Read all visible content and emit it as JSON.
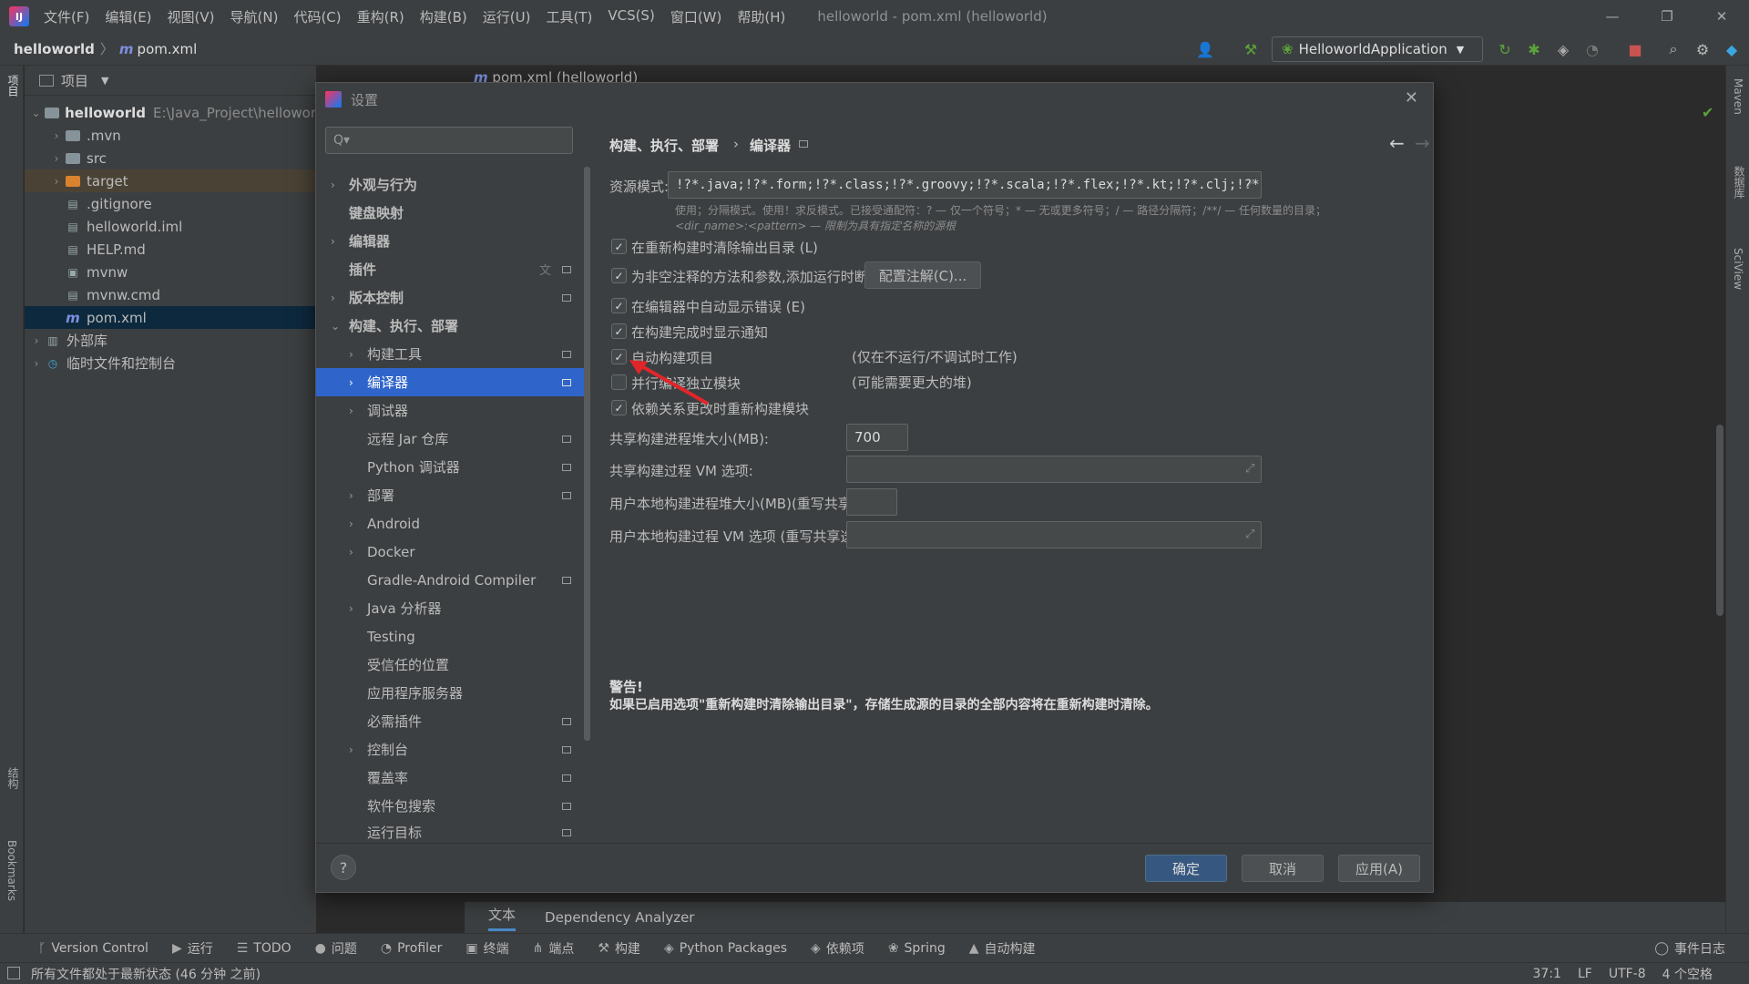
{
  "app": {
    "window_title": "helloworld - pom.xml (helloworld)",
    "menu": [
      "文件(F)",
      "编辑(E)",
      "视图(V)",
      "导航(N)",
      "代码(C)",
      "重构(R)",
      "构建(B)",
      "运行(U)",
      "工具(T)",
      "VCS(S)",
      "窗口(W)",
      "帮助(H)"
    ]
  },
  "navbar": {
    "project": "helloworld",
    "file": "pom.xml",
    "run_config": "HelloworldApplication"
  },
  "project_panel": {
    "title": "项目",
    "root_name": "helloworld",
    "root_path": "E:\\Java_Project\\hellowor",
    "items": [
      ".mvn",
      "src",
      "target",
      ".gitignore",
      "helloworld.iml",
      "HELP.md",
      "mvnw",
      "mvnw.cmd",
      "pom.xml"
    ],
    "external_libs": "外部库",
    "scratches": "临时文件和控制台"
  },
  "editor": {
    "tab": "pom.xml (helloworld)"
  },
  "left_stripe": {
    "project": "项目",
    "structure": "结构",
    "bookmarks": "Bookmarks"
  },
  "right_stripe": {
    "maven": "Maven",
    "database": "数据库",
    "sciview": "SciView"
  },
  "bottom_tabs": {
    "text": "文本",
    "dependency": "Dependency Analyzer"
  },
  "tool_windows": [
    "Version Control",
    "运行",
    "TODO",
    "问题",
    "Profiler",
    "终端",
    "端点",
    "构建",
    "Python Packages",
    "依赖项",
    "Spring",
    "自动构建"
  ],
  "event_log": "事件日志",
  "status": {
    "message": "所有文件都处于最新状态 (46 分钟 之前)",
    "position": "37:1",
    "line_sep": "LF",
    "encoding": "UTF-8",
    "indent": "4 个空格"
  },
  "dialog": {
    "title": "设置",
    "search_placeholder": "Q▾",
    "breadcrumb_parent": "构建、执行、部署",
    "breadcrumb_current": "编译器",
    "tree": [
      {
        "label": "外观与行为",
        "arrow": true,
        "indent": 0,
        "mark": false
      },
      {
        "label": "键盘映射",
        "arrow": false,
        "indent": 0,
        "mark": false
      },
      {
        "label": "编辑器",
        "arrow": true,
        "indent": 0,
        "mark": false
      },
      {
        "label": "插件",
        "arrow": false,
        "indent": 0,
        "mark": true
      },
      {
        "label": "版本控制",
        "arrow": true,
        "indent": 0,
        "mark": true
      },
      {
        "label": "构建、执行、部署",
        "arrow": true,
        "indent": 0,
        "mark": false
      },
      {
        "label": "构建工具",
        "arrow": true,
        "indent": 1,
        "mark": true
      },
      {
        "label": "编译器",
        "arrow": true,
        "indent": 1,
        "mark": true
      },
      {
        "label": "调试器",
        "arrow": true,
        "indent": 1,
        "mark": false
      },
      {
        "label": "远程 Jar 仓库",
        "arrow": false,
        "indent": 1,
        "mark": true
      },
      {
        "label": "Python 调试器",
        "arrow": false,
        "indent": 1,
        "mark": true
      },
      {
        "label": "部署",
        "arrow": true,
        "indent": 1,
        "mark": true
      },
      {
        "label": "Android",
        "arrow": true,
        "indent": 1,
        "mark": false
      },
      {
        "label": "Docker",
        "arrow": true,
        "indent": 1,
        "mark": false
      },
      {
        "label": "Gradle-Android Compiler",
        "arrow": false,
        "indent": 1,
        "mark": true
      },
      {
        "label": "Java 分析器",
        "arrow": true,
        "indent": 1,
        "mark": false
      },
      {
        "label": "Testing",
        "arrow": false,
        "indent": 1,
        "mark": false
      },
      {
        "label": "受信任的位置",
        "arrow": false,
        "indent": 1,
        "mark": false
      },
      {
        "label": "应用程序服务器",
        "arrow": false,
        "indent": 1,
        "mark": false
      },
      {
        "label": "必需插件",
        "arrow": false,
        "indent": 1,
        "mark": true
      },
      {
        "label": "控制台",
        "arrow": true,
        "indent": 1,
        "mark": true
      },
      {
        "label": "覆盖率",
        "arrow": false,
        "indent": 1,
        "mark": true
      },
      {
        "label": "软件包搜索",
        "arrow": false,
        "indent": 1,
        "mark": true
      },
      {
        "label": "运行目标",
        "arrow": false,
        "indent": 1,
        "mark": true
      }
    ],
    "resource_label": "资源模式:",
    "resource_value": "!?*.java;!?*.form;!?*.class;!?*.groovy;!?*.scala;!?*.flex;!?*.kt;!?*.clj;!?*.aj",
    "resource_hint1": "使用；分隔模式。使用！求反模式。已接受通配符：? — 仅一个符号；* — 无或更多符号；/ — 路径分隔符；/**/ — 任何数量的目录；",
    "resource_hint2": "<dir_name>:<pattern> — 限制为具有指定名称的源根",
    "options": [
      {
        "label": "在重新构建时清除输出目录 (L)",
        "checked": true
      },
      {
        "label": "为非空注释的方法和参数,添加运行时断言 (A)",
        "checked": true
      },
      {
        "label": "在编辑器中自动显示错误 (E)",
        "checked": true
      },
      {
        "label": "在构建完成时显示通知",
        "checked": true
      },
      {
        "label": "自动构建项目",
        "checked": true
      },
      {
        "label": "并行编译独立模块",
        "checked": false
      },
      {
        "label": "依赖关系更改时重新构建模块",
        "checked": true
      }
    ],
    "config_annotations": "配置注解(C)...",
    "auto_build_note": "(仅在不运行/不调试时工作)",
    "parallel_note": "(可能需要更大的堆)",
    "heap_label": "共享构建进程堆大小(MB):",
    "heap_value": "700",
    "vm_label": "共享构建过程 VM 选项:",
    "local_heap_label": "用户本地构建进程堆大小(MB)(重写共享大小):",
    "local_vm_label": "用户本地构建过程 VM 选项 (重写共享选项):",
    "warning_title": "警告!",
    "warning_text": "如果已启用选项\"重新构建时清除输出目录\"，存储生成源的目录的全部内容将在重新构建时清除。",
    "ok": "确定",
    "cancel": "取消",
    "apply": "应用(A)",
    "help": "?"
  },
  "colors": {
    "accent": "#2f65ca",
    "primary_button": "#365880",
    "arrow": "#e0262a"
  }
}
